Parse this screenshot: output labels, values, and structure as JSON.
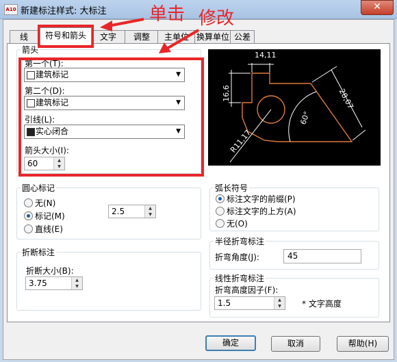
{
  "window": {
    "title": "新建标注样式: 大标注",
    "icon_text": "A10",
    "close_label": "✕"
  },
  "tabs": [
    {
      "label": "线"
    },
    {
      "label": "符号和箭头"
    },
    {
      "label": "文字"
    },
    {
      "label": "调整"
    },
    {
      "label": "主单位"
    },
    {
      "label": "换算单位"
    },
    {
      "label": "公差"
    }
  ],
  "annotations": {
    "click": "单击",
    "modify": "修改"
  },
  "arrows": {
    "title": "箭头",
    "first_label": "第一个(T):",
    "first_value": "建筑标记",
    "second_label": "第二个(D):",
    "second_value": "建筑标记",
    "leader_label": "引线(L):",
    "leader_value": "实心闭合",
    "size_label": "箭头大小(I):",
    "size_value": "60"
  },
  "center": {
    "title": "圆心标记",
    "options": [
      "无(N)",
      "标记(M)",
      "直线(E)"
    ],
    "selected": "标记(M)",
    "size_value": "2.5"
  },
  "break": {
    "title": "折断标注",
    "size_label": "折断大小(B):",
    "size_value": "3.75"
  },
  "arc": {
    "title": "弧长符号",
    "options": [
      "标注文字的前缀(P)",
      "标注文字的上方(A)",
      "无(O)"
    ],
    "selected": "标注文字的前缀(P)"
  },
  "radius_jog": {
    "title": "半径折弯标注",
    "angle_label": "折弯角度(J):",
    "angle_value": "45"
  },
  "linear_jog": {
    "title": "线性折弯标注",
    "factor_label": "折弯高度因子(F):",
    "factor_value": "1.5",
    "unit_text": "* 文字高度"
  },
  "preview": {
    "dim_top": "14,11",
    "dim_left": "16,6",
    "dim_right": "28,07",
    "dim_angle": "60°",
    "dim_radius": "R11,17"
  },
  "buttons": {
    "ok": "确定",
    "cancel": "取消",
    "help": "帮助(H)"
  },
  "colors": {
    "annotation_red": "#e8262a",
    "preview_bg": "#000000",
    "preview_lines": "#ffffff",
    "preview_geometry": "#e07b39"
  }
}
